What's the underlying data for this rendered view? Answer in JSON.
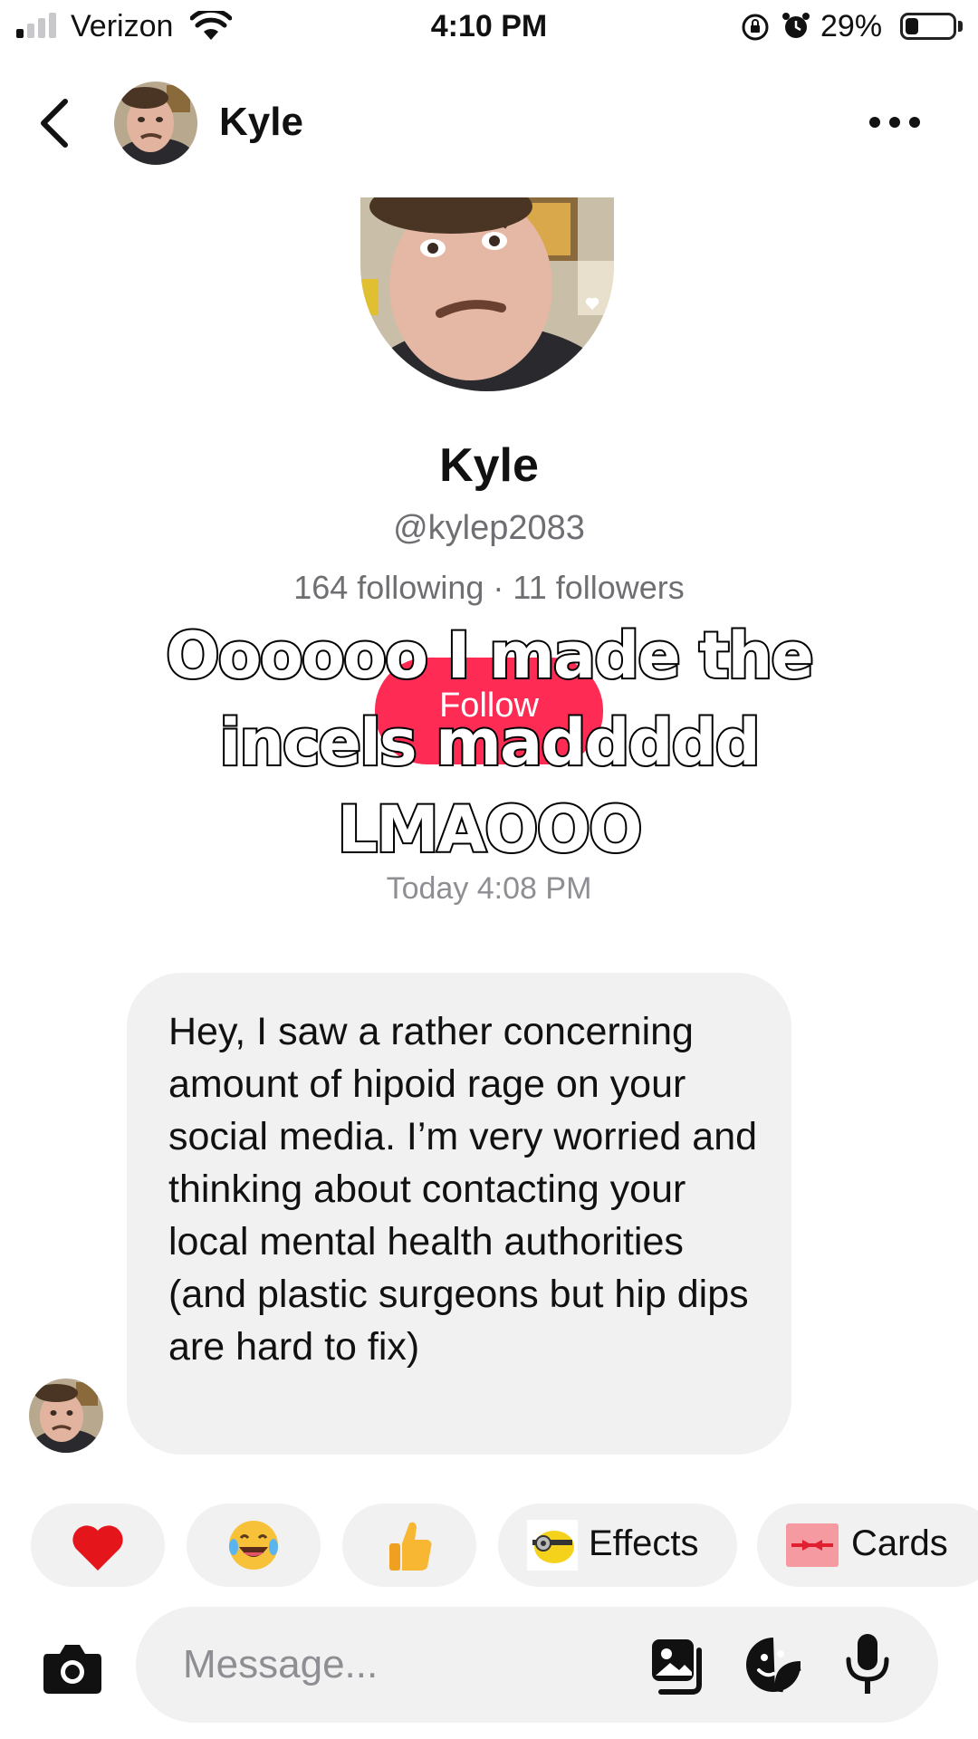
{
  "status_bar": {
    "carrier": "Verizon",
    "time": "4:10 PM",
    "battery_percent": "29%",
    "battery_level": 0.29,
    "signal_bars_active": 1
  },
  "header": {
    "contact_name": "Kyle",
    "back_icon": "chevron-left-icon",
    "more_icon": "more-horizontal-icon"
  },
  "profile": {
    "name": "Kyle",
    "handle": "@kylep2083",
    "stats": "164 following · 11 followers",
    "follow_label": "Follow"
  },
  "overlay_caption": "Oooooo I made the incels maddddd LMAOOO",
  "timestamp": "Today 4:08 PM",
  "message": {
    "text": "Hey, I saw a rather concerning amount of hipoid rage on your social media. I’m very worried and thinking about contacting your local mental health authorities (and plastic surgeons but hip dips are hard to fix)"
  },
  "quick_actions": {
    "heart": "❤",
    "laugh": "😂",
    "thumbs_up": "👍",
    "effects_label": "Effects",
    "cards_label": "Cards"
  },
  "composer": {
    "placeholder": "Message..."
  },
  "colors": {
    "follow_red": "#fe2c55",
    "bubble_gray": "#f1f1f2",
    "secondary_text": "#6e6e73"
  }
}
